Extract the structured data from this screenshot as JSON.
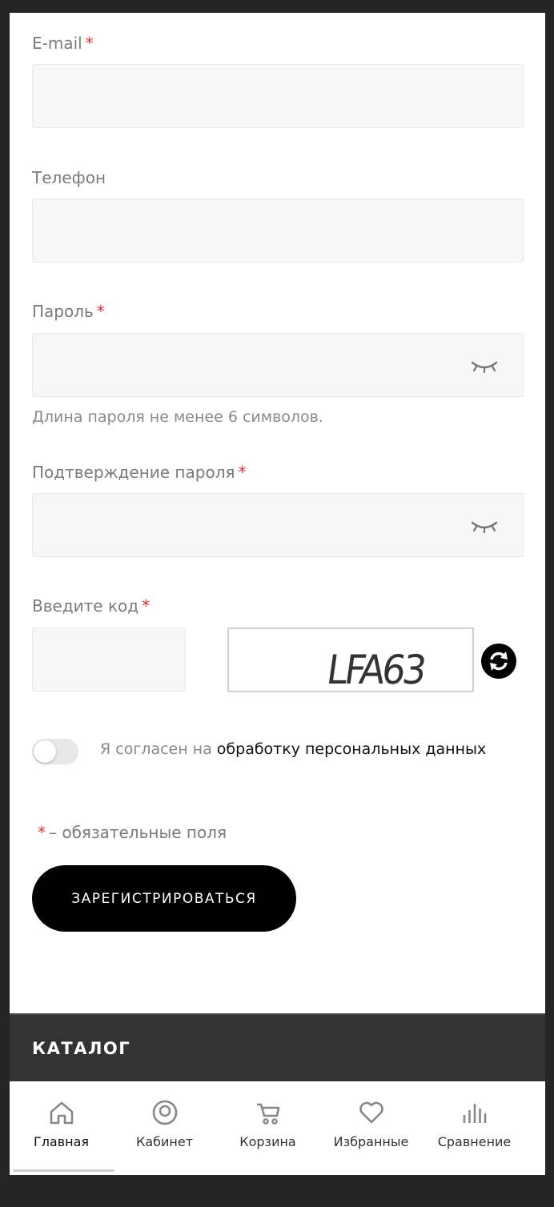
{
  "form": {
    "email_label": "E-mail",
    "phone_label": "Телефон",
    "password_label": "Пароль",
    "password_hint": "Длина пароля не менее 6 символов.",
    "confirm_label": "Подтверждение пароля",
    "code_label": "Введите код",
    "required_mark": "*",
    "captcha_text": "LFA63",
    "consent_prefix": "Я согласен на",
    "consent_link": "обработку персональных данных",
    "required_note": "– обязательные поля",
    "submit_label": "ЗАРЕГИСТРИРОВАТЬСЯ"
  },
  "catalog": {
    "title": "КАТАЛОГ"
  },
  "tabbar": {
    "items": [
      {
        "label": "Главная",
        "icon": "home-icon"
      },
      {
        "label": "Кабинет",
        "icon": "user-circle-icon"
      },
      {
        "label": "Корзина",
        "icon": "cart-icon"
      },
      {
        "label": "Избранные",
        "icon": "heart-icon"
      },
      {
        "label": "Сравнение",
        "icon": "bar-chart-icon"
      }
    ]
  },
  "colors": {
    "required": "#e0302f",
    "accent": "#000000",
    "field_bg": "#f7f7f7",
    "footer_bg": "#333333"
  }
}
